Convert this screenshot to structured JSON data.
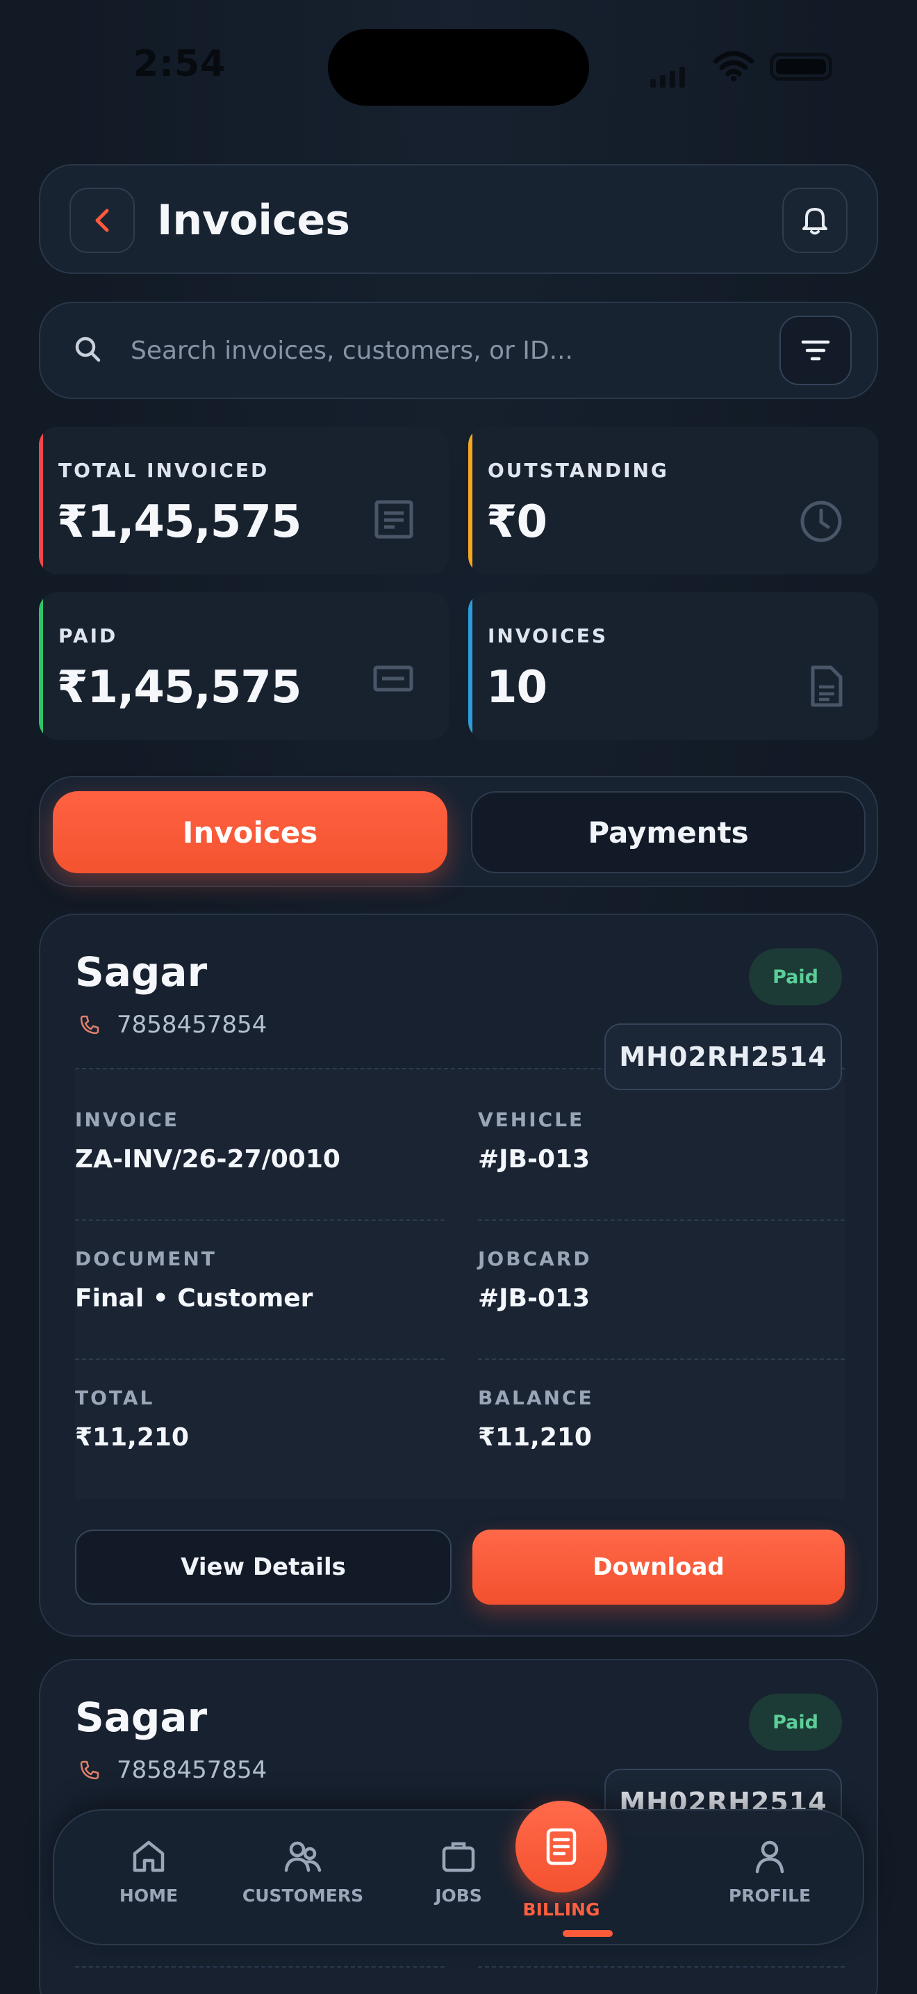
{
  "status_bar": {
    "time": "2:54"
  },
  "header": {
    "title": "Invoices"
  },
  "search": {
    "placeholder": "Search invoices, customers, or ID..."
  },
  "stats": [
    {
      "label": "TOTAL INVOICED",
      "value": "₹1,45,575",
      "accent": "#f0474a",
      "icon": "receipt-icon"
    },
    {
      "label": "OUTSTANDING",
      "value": "₹0",
      "accent": "#f5a623",
      "icon": "clock-icon"
    },
    {
      "label": "PAID",
      "value": "₹1,45,575",
      "accent": "#2fc46a",
      "icon": "card-icon"
    },
    {
      "label": "INVOICES",
      "value": "10",
      "accent": "#2d9cdb",
      "icon": "document-icon"
    }
  ],
  "tabs": {
    "invoices": "Invoices",
    "payments": "Payments",
    "active": "invoices"
  },
  "invoices": [
    {
      "customer": "Sagar",
      "phone": "7858457854",
      "status": "Paid",
      "plate": "MH02RH2514",
      "invoice_label": "INVOICE",
      "invoice_no": "ZA-INV/26-27/0010",
      "vehicle_label": "VEHICLE",
      "vehicle": "#JB-013",
      "document_label": "DOCUMENT",
      "document": "Final • Customer",
      "jobcard_label": "JOBCARD",
      "jobcard": "#JB-013",
      "total_label": "TOTAL",
      "total": "₹11,210",
      "balance_label": "BALANCE",
      "balance": "₹11,210",
      "view_label": "View Details",
      "download_label": "Download"
    },
    {
      "customer": "Sagar",
      "phone": "7858457854",
      "status": "Paid",
      "plate": "MH02RH2514"
    }
  ],
  "nav": [
    {
      "label": "HOME",
      "icon": "home-icon"
    },
    {
      "label": "CUSTOMERS",
      "icon": "users-icon"
    },
    {
      "label": "JOBS",
      "icon": "briefcase-icon"
    },
    {
      "label": "BILLING",
      "icon": "document-icon",
      "active": true
    },
    {
      "label": "PROFILE",
      "icon": "user-icon"
    }
  ],
  "colors": {
    "accent": "#ff5a3a",
    "paid_badge": "#5ccf99"
  }
}
